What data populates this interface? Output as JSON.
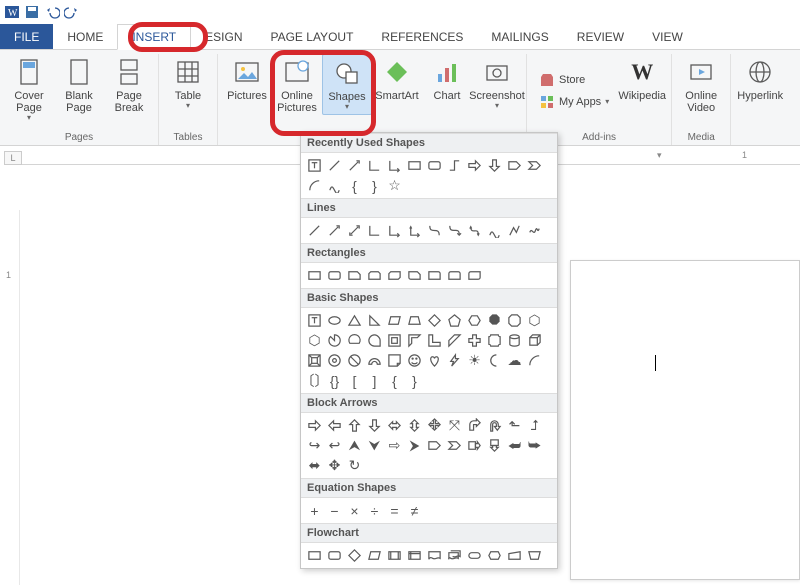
{
  "qat": {
    "save_title": "Save",
    "undo_title": "Undo",
    "redo_title": "Redo"
  },
  "tabs": {
    "file": "FILE",
    "home": "HOME",
    "insert": "INSERT",
    "design": "ESIGN",
    "pagelayout": "PAGE LAYOUT",
    "references": "REFERENCES",
    "mailings": "MAILINGS",
    "review": "REVIEW",
    "view": "VIEW"
  },
  "ribbon": {
    "pages": {
      "label": "Pages",
      "cover": "Cover Page",
      "blank": "Blank Page",
      "break": "Page Break"
    },
    "tables": {
      "label": "Tables",
      "table": "Table"
    },
    "illustrations": {
      "pictures": "Pictures",
      "online_pictures": "Online Pictures",
      "shapes": "Shapes",
      "smartart": "SmartArt",
      "chart": "Chart",
      "screenshot": "Screenshot"
    },
    "addins": {
      "label": "Add-ins",
      "store": "Store",
      "myapps": "My Apps",
      "wikipedia": "Wikipedia"
    },
    "media": {
      "label": "Media",
      "video": "Online Video"
    },
    "links": {
      "hyperlink": "Hyperlink"
    }
  },
  "shapes_dropdown": {
    "recent": "Recently Used Shapes",
    "lines": "Lines",
    "rectangles": "Rectangles",
    "basic": "Basic Shapes",
    "block": "Block Arrows",
    "equation": "Equation Shapes",
    "flowchart": "Flowchart"
  },
  "ruler_corner": "L"
}
